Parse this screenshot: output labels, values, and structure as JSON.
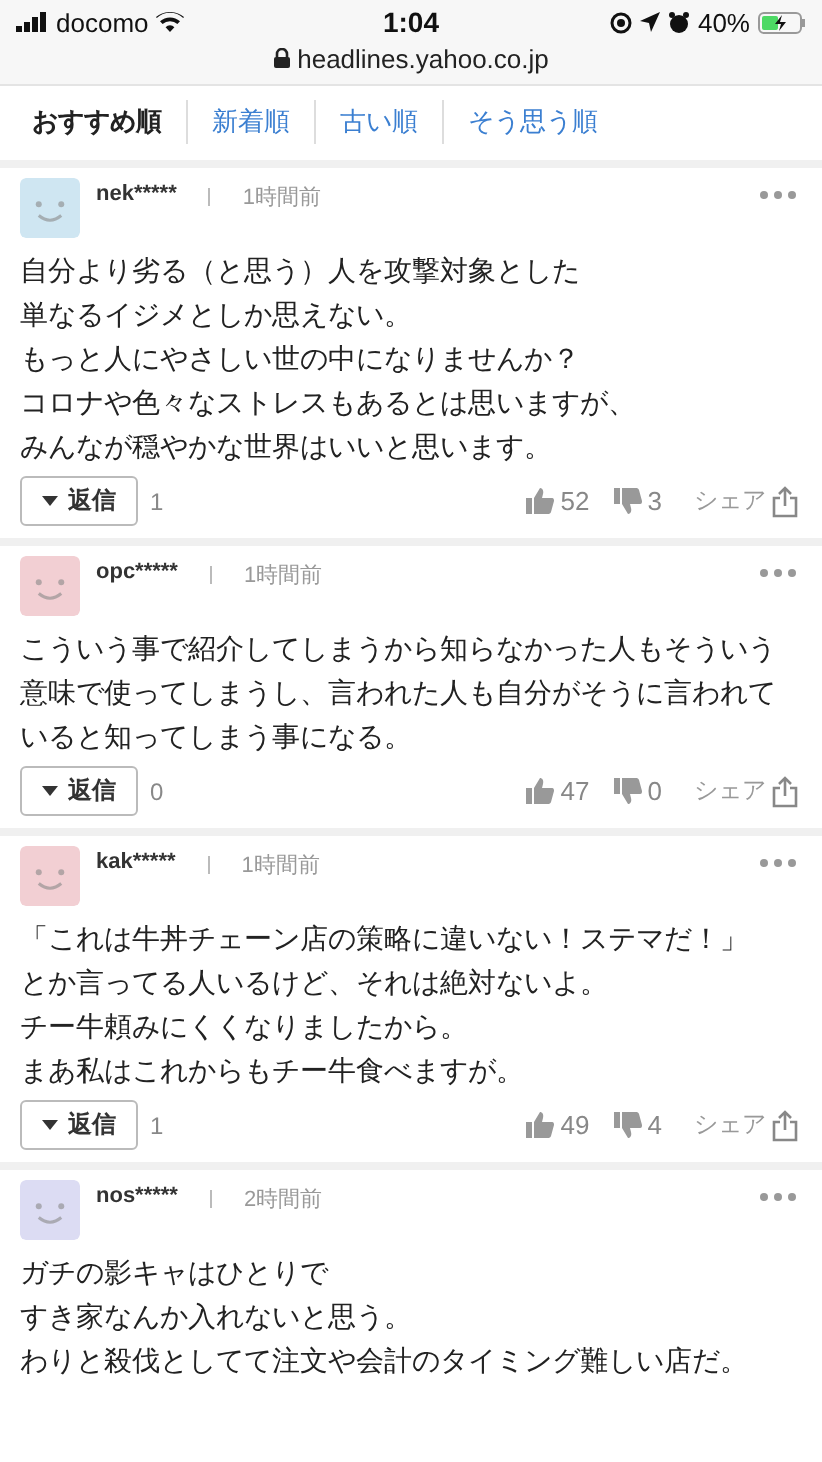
{
  "status_bar": {
    "carrier": "docomo",
    "time": "1:04",
    "battery": "40%"
  },
  "url": "headlines.yahoo.co.jp",
  "tabs": [
    {
      "label": "おすすめ順",
      "selected": true
    },
    {
      "label": "新着順",
      "selected": false
    },
    {
      "label": "古い順",
      "selected": false
    },
    {
      "label": "そう思う順",
      "selected": false
    }
  ],
  "comments": [
    {
      "user": "nek*****",
      "time": "1時間前",
      "color": "#cfe6f2",
      "lines": [
        "自分より劣る（と思う）人を攻撃対象とした",
        "単なるイジメとしか思えない。",
        "もっと人にやさしい世の中になりませんか？",
        "コロナや色々なストレスもあるとは思いますが、",
        "みんなが穏やかな世界はいいと思います。"
      ],
      "reply_label": "返信",
      "replies": "1",
      "likes": "52",
      "dislikes": "3",
      "share": "シェア"
    },
    {
      "user": "opc*****",
      "time": "1時間前",
      "color": "#f2cfd3",
      "lines": [
        "こういう事で紹介してしまうから知らなかった人もそういう意味で使ってしまうし、言われた人も自分がそうに言われていると知ってしまう事になる。"
      ],
      "reply_label": "返信",
      "replies": "0",
      "likes": "47",
      "dislikes": "0",
      "share": "シェア"
    },
    {
      "user": "kak*****",
      "time": "1時間前",
      "color": "#f2cfd3",
      "lines": [
        "「これは牛丼チェーン店の策略に違いない！ステマだ！」",
        "とか言ってる人いるけど、それは絶対ないよ。",
        "チー牛頼みにくくなりましたから。",
        "まあ私はこれからもチー牛食べますが。"
      ],
      "reply_label": "返信",
      "replies": "1",
      "likes": "49",
      "dislikes": "4",
      "share": "シェア"
    },
    {
      "user": "nos*****",
      "time": "2時間前",
      "color": "#dcdcf3",
      "lines": [
        "ガチの影キャはひとりで",
        "すき家なんか入れないと思う。",
        "わりと殺伐としてて注文や会計のタイミング難しい店だ。"
      ]
    }
  ]
}
